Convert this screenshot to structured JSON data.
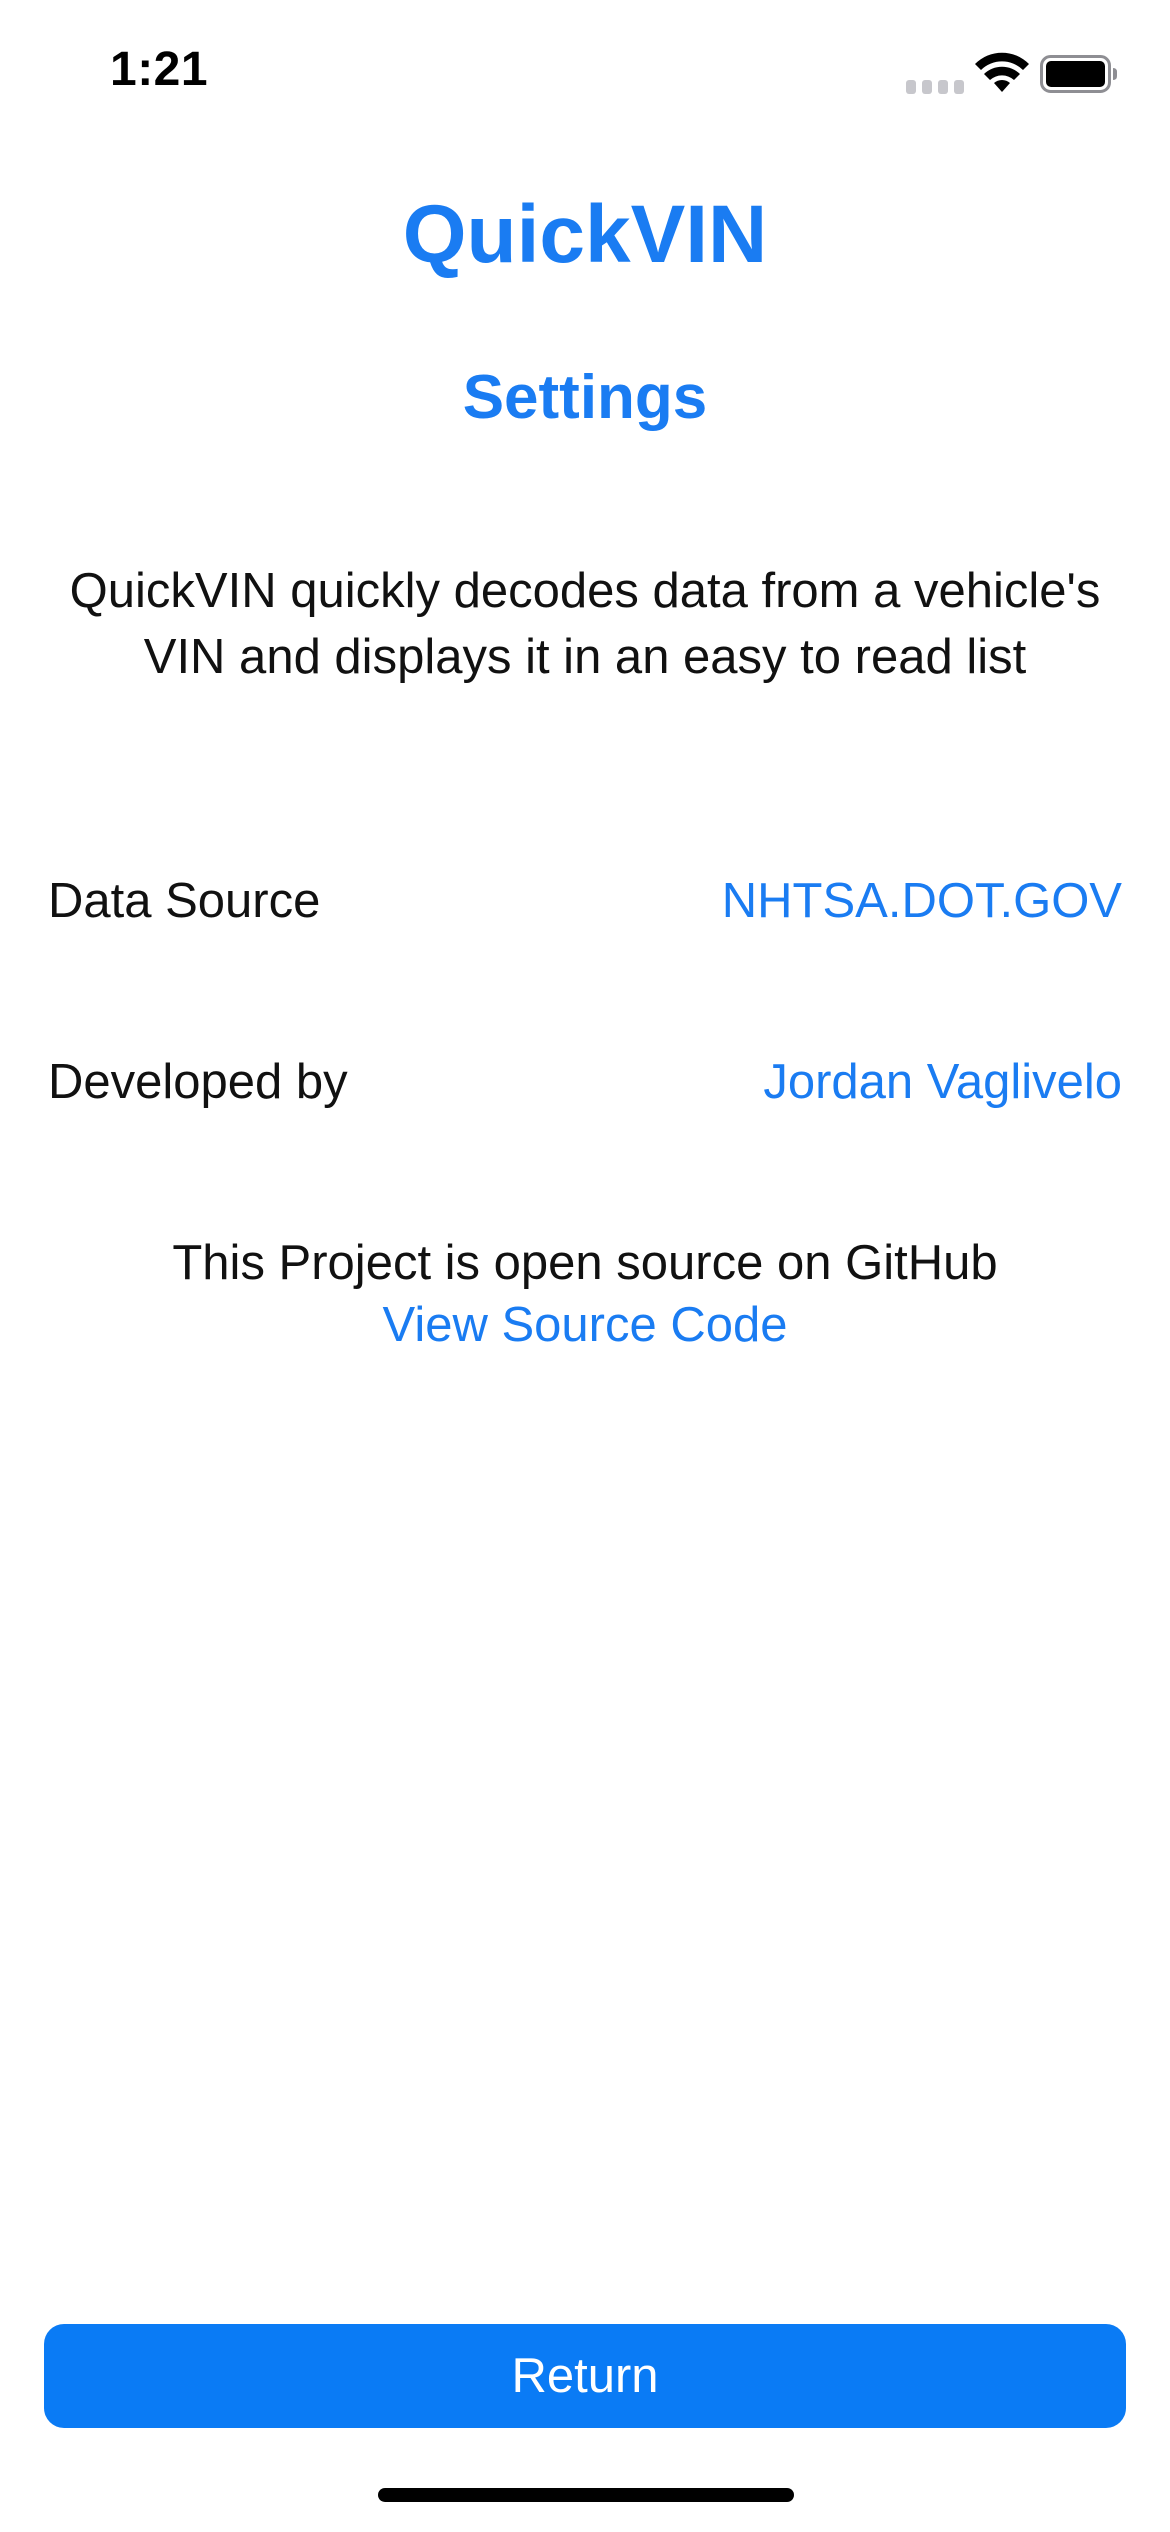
{
  "status_bar": {
    "time": "1:21",
    "icons": [
      "signal-icon",
      "wifi-icon",
      "battery-icon"
    ]
  },
  "header": {
    "app_title": "QuickVIN",
    "page_title": "Settings"
  },
  "main": {
    "description": "QuickVIN quickly decodes data from a vehicle's VIN and displays it in an easy to read list",
    "rows": [
      {
        "label": "Data Source",
        "value": "NHTSA.DOT.GOV"
      },
      {
        "label": "Developed by",
        "value": "Jordan Vaglivelo"
      }
    ],
    "open_source_text": "This Project is open source on GitHub",
    "source_link": "View Source Code"
  },
  "footer": {
    "return_label": "Return"
  },
  "colors": {
    "accent": "#1a7cf2",
    "button": "#0a7bf5",
    "background": "#ffffff",
    "text": "#111111"
  }
}
